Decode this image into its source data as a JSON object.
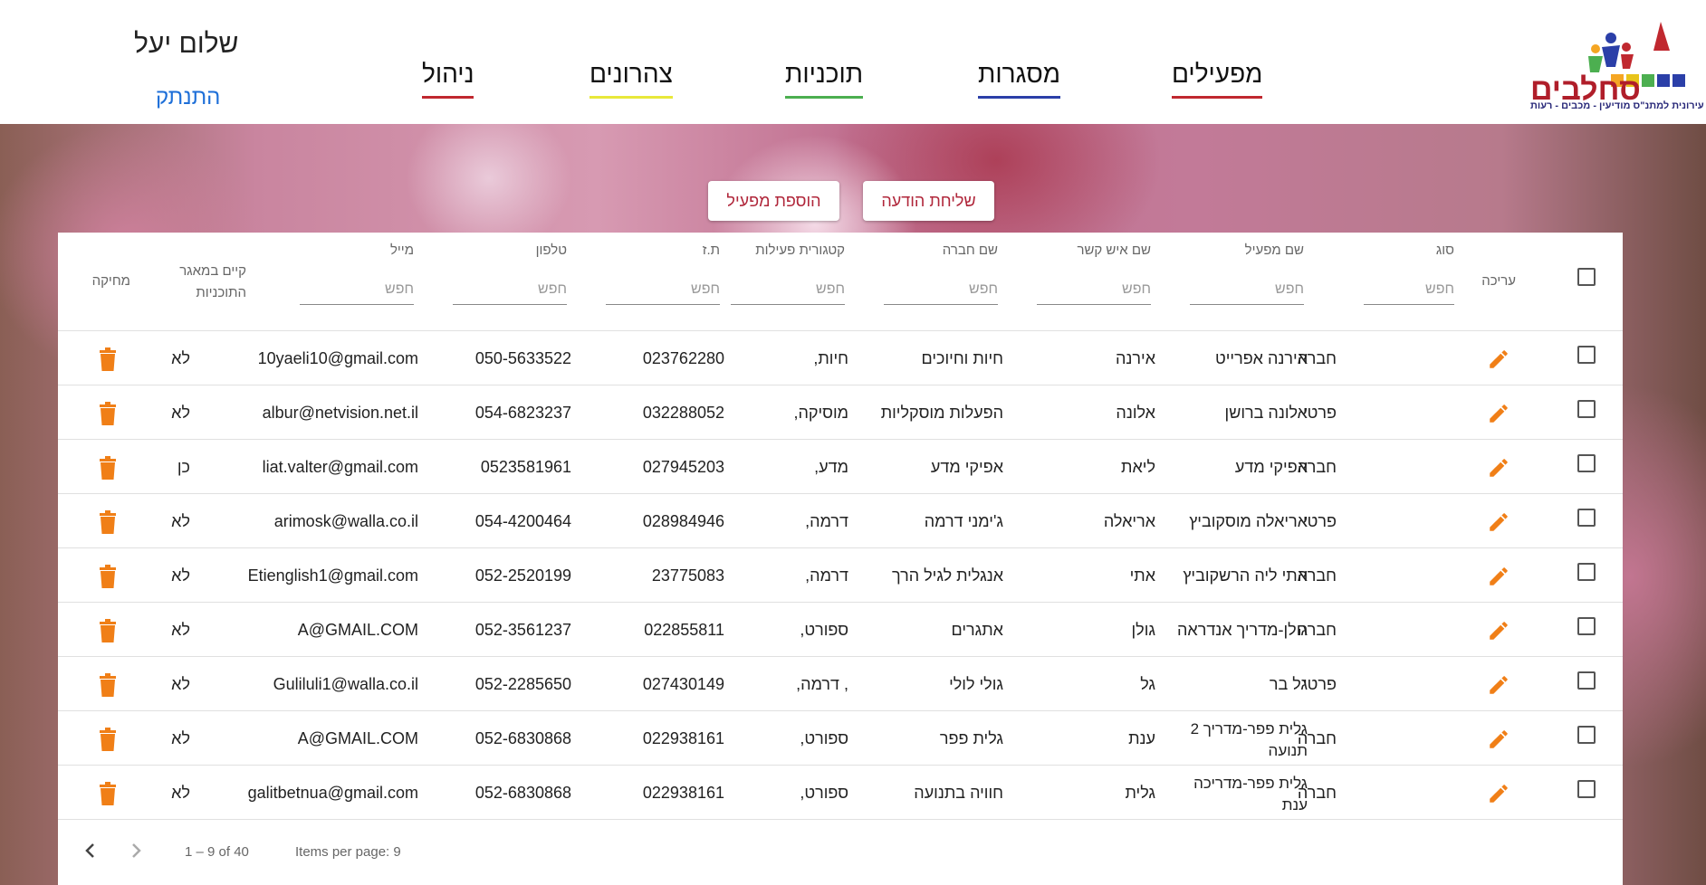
{
  "brand": {
    "name": "סחלבים",
    "subtitle": "עמותה עירונית למתנ\"ס מודיעין - מכבים - רעות"
  },
  "nav": [
    {
      "label": "מפעילים",
      "color": "#c0282f"
    },
    {
      "label": "מסגרות",
      "color": "#2b3fa8"
    },
    {
      "label": "תוכניות",
      "color": "#4caf50"
    },
    {
      "label": "צהרונים",
      "color": "#e8e83a"
    },
    {
      "label": "ניהול",
      "color": "#c0282f"
    }
  ],
  "user": {
    "greeting": "שלום יעל",
    "logout": "התנתק"
  },
  "actions": {
    "send_message": "שליחת הודעה",
    "add_operator": "הוספת מפעיל"
  },
  "table": {
    "columns": {
      "edit": "עריכה",
      "type": "סוג",
      "operator_name": "שם מפעיל",
      "contact_name": "שם איש קשר",
      "company_name": "שם חברה",
      "category": "קטגורית פעילות",
      "id": "ת.ז",
      "phone": "טלפון",
      "email": "מייל",
      "in_pool": "קיים במאגר התוכניות",
      "delete": "מחיקה"
    },
    "filter_placeholder": "חפש",
    "rows": [
      {
        "type": "חברה",
        "operator_name": "אירנה אפרייט",
        "contact_name": "אירנה",
        "company_name": "חיות וחיוכים",
        "category": "חיות,",
        "id": "023762280",
        "phone": "050-5633522",
        "email": "10yaeli10@gmail.com",
        "in_pool": "לא"
      },
      {
        "type": "פרטי",
        "operator_name": "אלונה ברושן",
        "contact_name": "אלונה",
        "company_name": "הפעלות מוסקליות",
        "category": "מוסיקה,",
        "id": "032288052",
        "phone": "054-6823237",
        "email": "albur@netvision.net.il",
        "in_pool": "לא"
      },
      {
        "type": "חברה",
        "operator_name": "אפיקי מדע",
        "contact_name": "ליאת",
        "company_name": "אפיקי מדע",
        "category": "מדע,",
        "id": "027945203",
        "phone": "0523581961",
        "email": "liat.valter@gmail.com",
        "in_pool": "כן"
      },
      {
        "type": "פרטי",
        "operator_name": "אריאלה מוסקוביץ",
        "contact_name": "אריאלה",
        "company_name": "ג'ימני דרמה",
        "category": "דרמה,",
        "id": "028984946",
        "phone": "054-4200464",
        "email": "arimosk@walla.co.il",
        "in_pool": "לא"
      },
      {
        "type": "חברה",
        "operator_name": "אתי ליה הרשקוביץ",
        "contact_name": "אתי",
        "company_name": "אנגלית לגיל הרך",
        "category": "דרמה,",
        "id": "23775083",
        "phone": "052-2520199",
        "email": "Etienglish1@gmail.com",
        "in_pool": "לא"
      },
      {
        "type": "חברה",
        "operator_name": "גולן-מדריך אנדראה",
        "contact_name": "גולן",
        "company_name": "אתגרים",
        "category": "ספורט,",
        "id": "022855811",
        "phone": "052-3561237",
        "email": "A@GMAIL.COM",
        "in_pool": "לא"
      },
      {
        "type": "פרטי",
        "operator_name": "גל בר",
        "contact_name": "גל",
        "company_name": "גולי לולי",
        "category": ", דרמה,",
        "id": "027430149",
        "phone": "052-2285650",
        "email": "Guliluli1@walla.co.il",
        "in_pool": "לא"
      },
      {
        "type": "חברה",
        "operator_name": "גלית פפר-מדריך 2 תנועה",
        "contact_name": "ענת",
        "company_name": "גלית פפר",
        "category": "ספורט,",
        "id": "022938161",
        "phone": "052-6830868",
        "email": "A@GMAIL.COM",
        "in_pool": "לא"
      },
      {
        "type": "חברה",
        "operator_name": "גלית פפר-מדריכה ענת",
        "contact_name": "גלית",
        "company_name": "חוויה בתנועה",
        "category": "ספורט,",
        "id": "022938161",
        "phone": "052-6830868",
        "email": "galitbetnua@gmail.com",
        "in_pool": "לא"
      }
    ]
  },
  "paginator": {
    "items_per_page": "Items per page: 9",
    "range": "1 – 9 of 40"
  },
  "colors": {
    "accent": "#b0263a",
    "icon_orange": "#f07f17",
    "link_blue": "#1e6fd8"
  }
}
